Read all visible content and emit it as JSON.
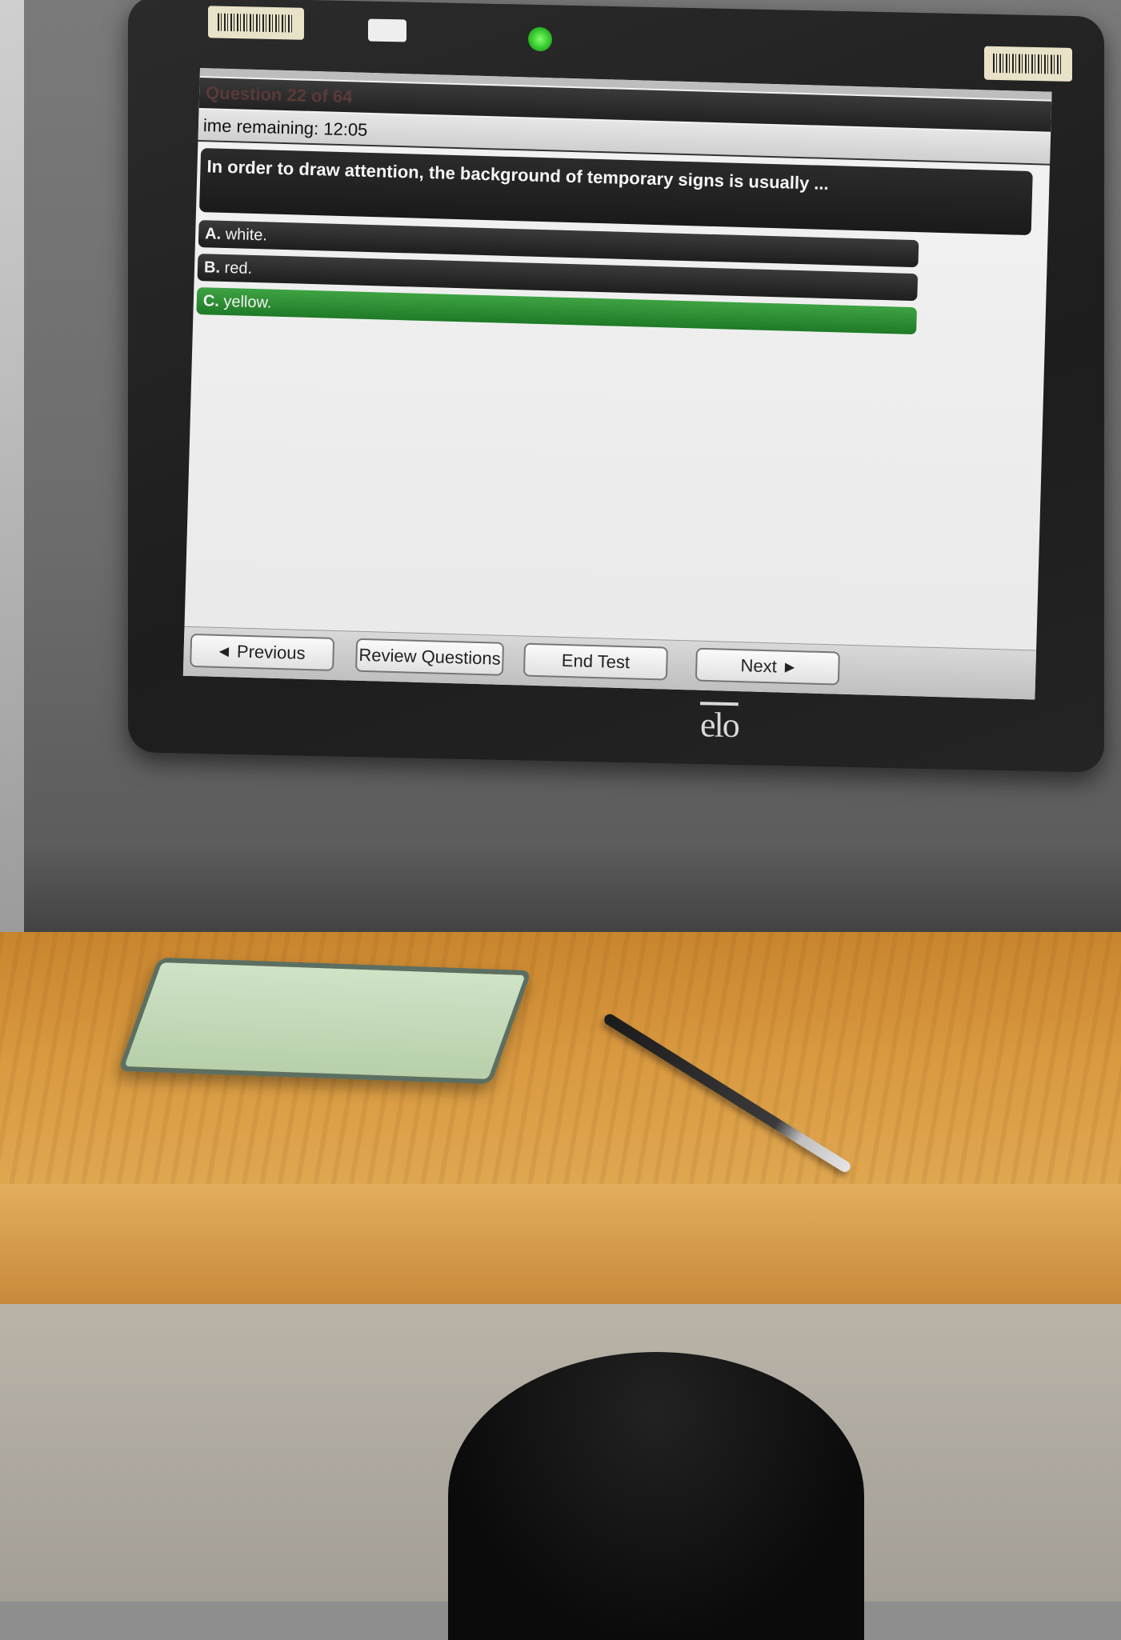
{
  "screen": {
    "question_header": "Question 22 of 64",
    "timer_text": "ime remaining: 12:05",
    "question_text": "In order to draw attention, the background of temporary signs is usually ...",
    "answers": [
      {
        "letter": "A.",
        "text": "white.",
        "selected": false
      },
      {
        "letter": "B.",
        "text": "red.",
        "selected": false
      },
      {
        "letter": "C.",
        "text": "yellow.",
        "selected": true
      }
    ],
    "nav": {
      "previous": "Previous",
      "review": "Review Questions",
      "end": "End Test",
      "next": "Next"
    }
  },
  "device": {
    "brand_logo": "elo"
  },
  "colors": {
    "selected_answer": "#2e8f36",
    "answer_bar": "#262626",
    "led": "#3fd33a"
  },
  "icons": {
    "previous": "triangle-left-icon",
    "next": "triangle-right-icon",
    "cursor": "pointer-icon"
  }
}
